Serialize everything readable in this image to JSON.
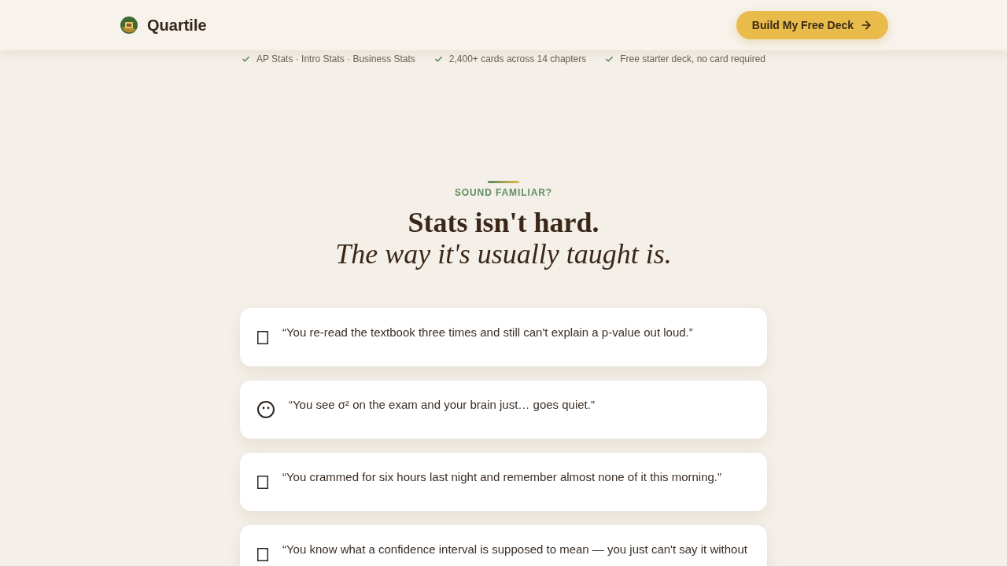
{
  "header": {
    "brand": "Quartile",
    "cta": "Build My Free Deck"
  },
  "highlights": [
    "AP Stats · Intro Stats · Business Stats",
    "2,400+ cards across 14 chapters",
    "Free starter deck, no card required"
  ],
  "section": {
    "eyebrow": "SOUND FAMILIAR?",
    "title": "Stats isn't hard.",
    "subtitle": "The way it's usually taught is."
  },
  "pain_points": [
    {
      "kind": "glyph",
      "quote": "“You re-read the textbook three times and still can't explain a p-value out loud.”"
    },
    {
      "kind": "face",
      "quote": "“You see σ² on the exam and your brain just… goes quiet.”"
    },
    {
      "kind": "glyph",
      "quote": "“You crammed for six hours last night and remember almost none of it this morning.”"
    },
    {
      "kind": "glyph",
      "quote": "“You know what a confidence interval is supposed to mean — you just can't say it without"
    }
  ]
}
